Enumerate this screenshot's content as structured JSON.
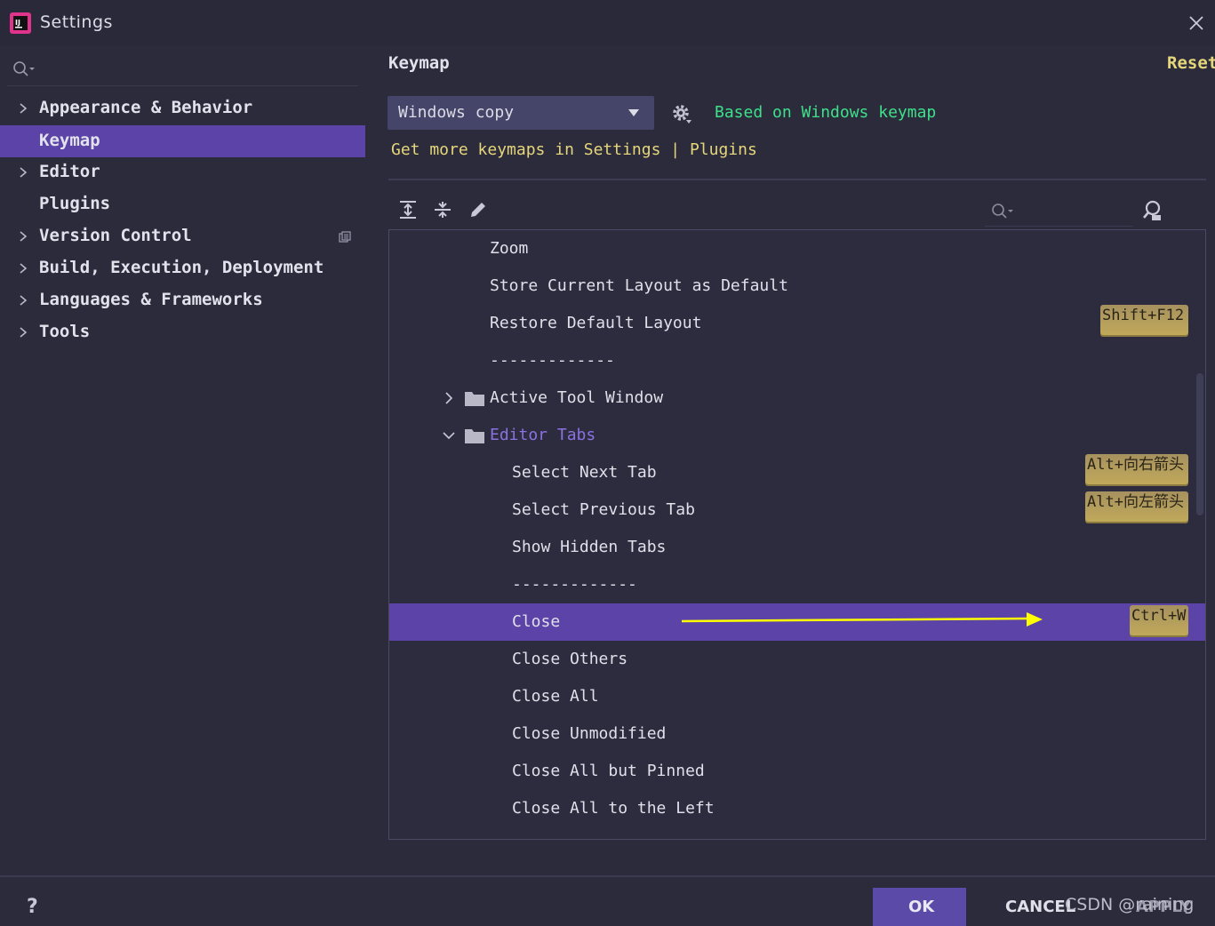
{
  "window": {
    "title": "Settings"
  },
  "sidebar": {
    "items": [
      {
        "label": "Appearance & Behavior",
        "expandable": true
      },
      {
        "label": "Keymap",
        "expandable": false,
        "selected": true
      },
      {
        "label": "Editor",
        "expandable": true
      },
      {
        "label": "Plugins",
        "expandable": false
      },
      {
        "label": "Version Control",
        "expandable": true
      },
      {
        "label": "Build, Execution, Deployment",
        "expandable": true
      },
      {
        "label": "Languages & Frameworks",
        "expandable": true
      },
      {
        "label": "Tools",
        "expandable": true
      }
    ]
  },
  "main": {
    "title": "Keymap",
    "reset_label": "Reset",
    "keymap_select": {
      "value": "Windows copy"
    },
    "based_on": "Based on Windows keymap",
    "more_keymaps": "Get more keymaps in Settings | Plugins"
  },
  "tree": {
    "rows": [
      {
        "label": "Zoom"
      },
      {
        "label": "Store Current Layout as Default"
      },
      {
        "label": "Restore Default Layout",
        "shortcut": "Shift+F12"
      },
      {
        "label": "-------------"
      },
      {
        "label": "Active Tool Window",
        "folder": true,
        "expanded": false
      },
      {
        "label": "Editor Tabs",
        "folder": true,
        "expanded": true
      },
      {
        "label": "Select Next Tab",
        "shortcut": "Alt+向右箭头"
      },
      {
        "label": "Select Previous Tab",
        "shortcut": "Alt+向左箭头"
      },
      {
        "label": "Show Hidden Tabs"
      },
      {
        "label": "-------------"
      },
      {
        "label": "Close",
        "shortcut": "Ctrl+W",
        "selected": true
      },
      {
        "label": "Close Others"
      },
      {
        "label": "Close All"
      },
      {
        "label": "Close Unmodified"
      },
      {
        "label": "Close All but Pinned"
      },
      {
        "label": "Close All to the Left"
      }
    ]
  },
  "buttons": {
    "help": "?",
    "ok": "OK",
    "cancel": "CANCEL",
    "apply": "APPLY"
  },
  "watermark": "CSDN @raining",
  "colors": {
    "accent": "#5b43a8",
    "link_yellow": "#e6d67a",
    "based_green": "#3ee08a",
    "folder_open_text": "#8a72e0",
    "annotation_arrow": "#ffff00"
  }
}
